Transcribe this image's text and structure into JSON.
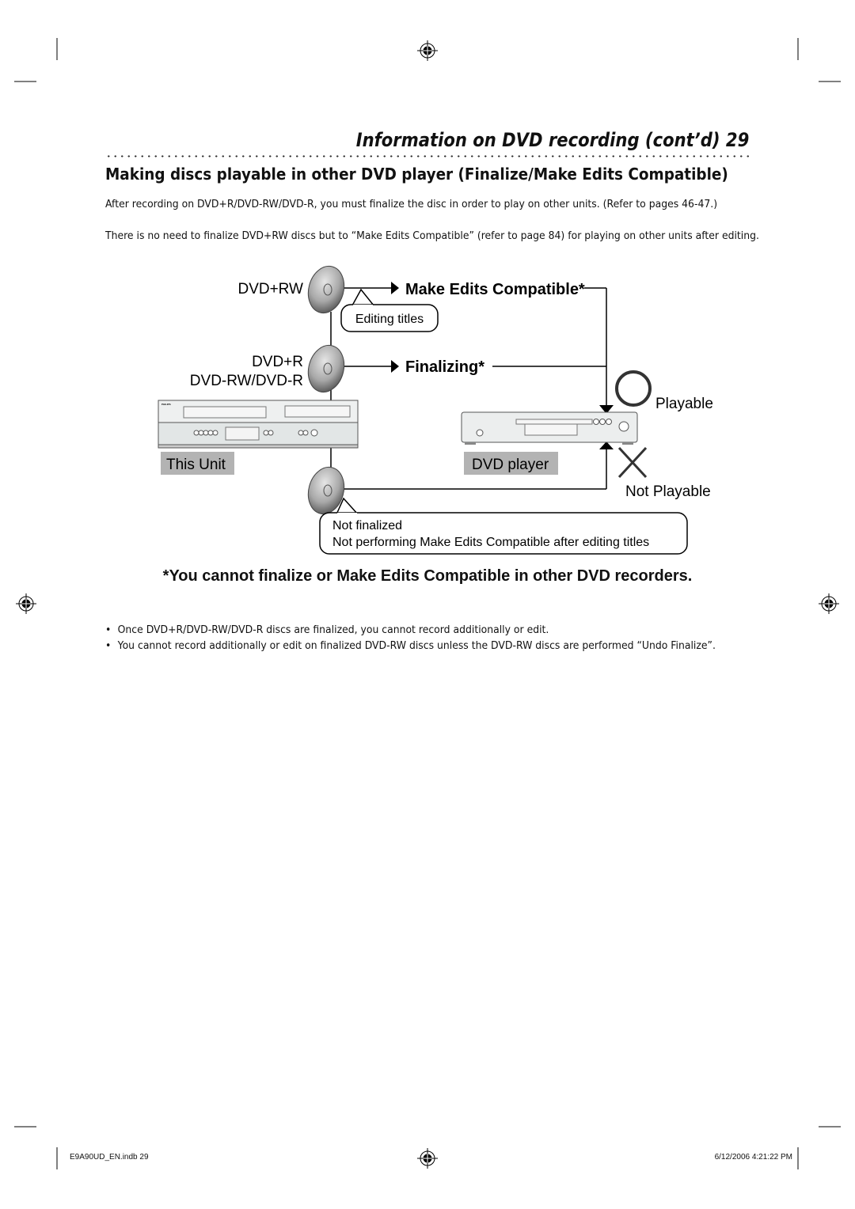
{
  "header": {
    "title": "Information on DVD recording (cont’d)  29"
  },
  "section": {
    "heading": "Making discs playable in other DVD player (Finalize/Make Edits Compatible)"
  },
  "paragraphs": [
    "After recording on DVD+R/DVD-RW/DVD-R, you must finalize the disc in order to play on other units. (Refer to pages 46-47.)",
    "There is no need to finalize DVD+RW discs but to “Make Edits Compatible” (refer to page 84) for playing on other units after editing."
  ],
  "diagram": {
    "dvd_rw_plus": "DVD+RW",
    "dvd_r_plus": "DVD+R",
    "dvd_rw_r": "DVD-RW/DVD-R",
    "make_edits": "Make Edits Compatible*",
    "editing_titles": "Editing titles",
    "finalizing": "Finalizing*",
    "playable": "Playable",
    "not_playable": "Not Playable",
    "this_unit": "This Unit",
    "dvd_player": "DVD player",
    "not_finalized": "Not finalized",
    "not_performing": "Not performing Make Edits Compatible after editing titles",
    "recorder_brand": "PHILIPS"
  },
  "note": "*You cannot finalize or Make Edits Compatible in other DVD recorders.",
  "bullets": [
    "Once DVD+R/DVD-RW/DVD-R discs are finalized, you cannot record additionally or edit.",
    "You cannot record additionally or edit on finalized DVD-RW discs unless the DVD-RW discs are performed “Undo Finalize”."
  ],
  "bullet_symbol": "•",
  "footer": {
    "left": "E9A90UD_EN.indb   29",
    "right": "6/12/2006   4:21:22 PM"
  }
}
